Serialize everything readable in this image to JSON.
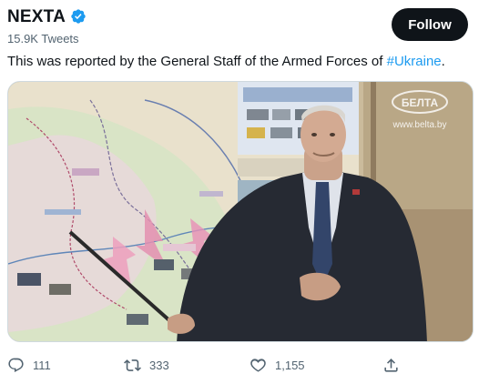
{
  "author": {
    "name": "NEXTA",
    "followers_label": "15.9K Tweets",
    "verified_color": "#1d9bf0"
  },
  "follow_button": {
    "label": "Follow"
  },
  "tweet": {
    "text_before": "This was reported by the General Staff of the Armed Forces of ",
    "hashtag": "#Ukraine",
    "text_after": "."
  },
  "media": {
    "watermark_logo": "БЕЛТА",
    "watermark_url": "www.belta.by"
  },
  "actions": {
    "replies": "111",
    "retweets": "333",
    "likes": "1,155"
  },
  "colors": {
    "link": "#1d9bf0",
    "secondary_text": "#536471",
    "follow_bg": "#0f1419"
  },
  "icons": [
    "verified-badge-icon",
    "reply-icon",
    "retweet-icon",
    "like-icon",
    "share-icon"
  ]
}
